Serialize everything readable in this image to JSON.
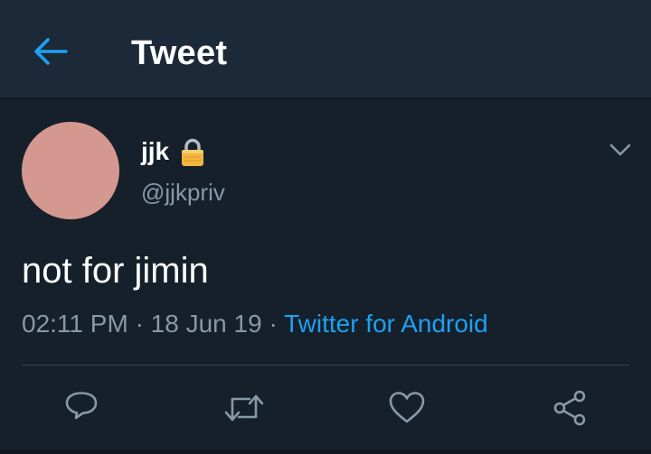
{
  "header": {
    "title": "Tweet",
    "back_icon": "arrow-left-icon",
    "accent_color": "#1da1f2"
  },
  "tweet": {
    "author": {
      "display_name": "jjk",
      "handle": "@jjkpriv",
      "protected_icon": "lock-icon",
      "avatar_color": "#d49890"
    },
    "text": "not for jimin",
    "time": "02:11 PM",
    "separator": "·",
    "date": "18 Jun 19",
    "source": "Twitter for Android",
    "menu_icon": "chevron-down-icon"
  },
  "actions": [
    {
      "icon": "reply-icon"
    },
    {
      "icon": "retweet-icon"
    },
    {
      "icon": "like-heart-icon"
    },
    {
      "icon": "share-icon"
    }
  ],
  "colors": {
    "background": "#15202b",
    "header_background": "#1c2938",
    "secondary_text": "#8899a6",
    "link": "#1da1f2"
  }
}
